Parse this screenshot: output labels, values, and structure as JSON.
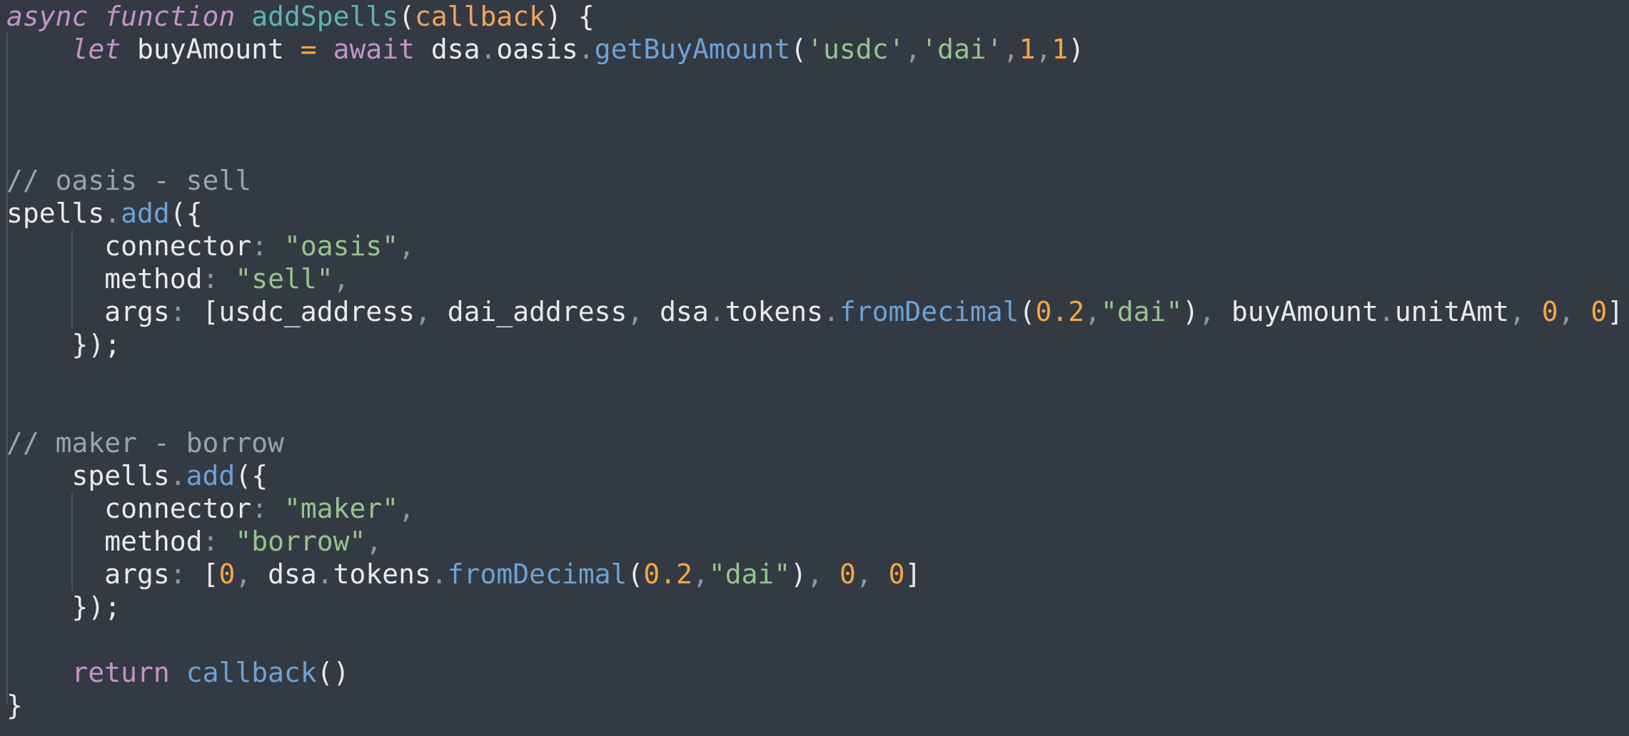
{
  "editor": {
    "theme_colors": {
      "background": "#333a44",
      "keyword": "#c792c8",
      "function_name": "#5fb3b3",
      "parameter": "#f0a45d",
      "method_call": "#6ea2d4",
      "string": "#97c48c",
      "number": "#f5a742",
      "comment": "#9aa3ad",
      "text": "#e8ebf0"
    },
    "lines": [
      {
        "tokens": [
          {
            "t": "async",
            "c": "kwi"
          },
          {
            "t": " ",
            "c": "plain"
          },
          {
            "t": "function",
            "c": "kwi"
          },
          {
            "t": " ",
            "c": "plain"
          },
          {
            "t": "addSpells",
            "c": "fn"
          },
          {
            "t": "(",
            "c": "plain"
          },
          {
            "t": "callback",
            "c": "param"
          },
          {
            "t": ") {",
            "c": "plain"
          }
        ]
      },
      {
        "tokens": [
          {
            "t": "    ",
            "c": "plain"
          },
          {
            "t": "let",
            "c": "kwi"
          },
          {
            "t": " buyAmount ",
            "c": "plain"
          },
          {
            "t": "=",
            "c": "op"
          },
          {
            "t": " ",
            "c": "plain"
          },
          {
            "t": "await",
            "c": "kw"
          },
          {
            "t": " dsa",
            "c": "plain"
          },
          {
            "t": ".",
            "c": "pun"
          },
          {
            "t": "oasis",
            "c": "plain"
          },
          {
            "t": ".",
            "c": "pun"
          },
          {
            "t": "getBuyAmount",
            "c": "call"
          },
          {
            "t": "(",
            "c": "plain"
          },
          {
            "t": "'usdc'",
            "c": "str"
          },
          {
            "t": ",",
            "c": "pun"
          },
          {
            "t": "'dai'",
            "c": "str"
          },
          {
            "t": ",",
            "c": "pun"
          },
          {
            "t": "1",
            "c": "num"
          },
          {
            "t": ",",
            "c": "pun"
          },
          {
            "t": "1",
            "c": "num"
          },
          {
            "t": ")",
            "c": "plain"
          }
        ]
      },
      {
        "tokens": []
      },
      {
        "tokens": []
      },
      {
        "tokens": []
      },
      {
        "tokens": [
          {
            "t": "// oasis - sell",
            "c": "cm"
          }
        ]
      },
      {
        "tokens": [
          {
            "t": "spells",
            "c": "plain"
          },
          {
            "t": ".",
            "c": "pun"
          },
          {
            "t": "add",
            "c": "call"
          },
          {
            "t": "({",
            "c": "plain"
          }
        ]
      },
      {
        "tokens": [
          {
            "t": "      connector",
            "c": "plain"
          },
          {
            "t": ": ",
            "c": "pun"
          },
          {
            "t": "\"oasis\"",
            "c": "str"
          },
          {
            "t": ",",
            "c": "pun"
          }
        ]
      },
      {
        "tokens": [
          {
            "t": "      method",
            "c": "plain"
          },
          {
            "t": ": ",
            "c": "pun"
          },
          {
            "t": "\"sell\"",
            "c": "str"
          },
          {
            "t": ",",
            "c": "pun"
          }
        ]
      },
      {
        "tokens": [
          {
            "t": "      args",
            "c": "plain"
          },
          {
            "t": ": ",
            "c": "pun"
          },
          {
            "t": "[usdc_address",
            "c": "plain"
          },
          {
            "t": ", ",
            "c": "pun"
          },
          {
            "t": "dai_address",
            "c": "plain"
          },
          {
            "t": ", ",
            "c": "pun"
          },
          {
            "t": "dsa",
            "c": "plain"
          },
          {
            "t": ".",
            "c": "pun"
          },
          {
            "t": "tokens",
            "c": "plain"
          },
          {
            "t": ".",
            "c": "pun"
          },
          {
            "t": "fromDecimal",
            "c": "call"
          },
          {
            "t": "(",
            "c": "plain"
          },
          {
            "t": "0.2",
            "c": "num"
          },
          {
            "t": ",",
            "c": "pun"
          },
          {
            "t": "\"dai\"",
            "c": "str"
          },
          {
            "t": ")",
            "c": "plain"
          },
          {
            "t": ", ",
            "c": "pun"
          },
          {
            "t": "buyAmount",
            "c": "plain"
          },
          {
            "t": ".",
            "c": "pun"
          },
          {
            "t": "unitAmt",
            "c": "plain"
          },
          {
            "t": ", ",
            "c": "pun"
          },
          {
            "t": "0",
            "c": "num"
          },
          {
            "t": ", ",
            "c": "pun"
          },
          {
            "t": "0",
            "c": "num"
          },
          {
            "t": "]",
            "c": "plain"
          }
        ]
      },
      {
        "tokens": [
          {
            "t": "    });",
            "c": "plain"
          }
        ]
      },
      {
        "tokens": []
      },
      {
        "tokens": []
      },
      {
        "tokens": [
          {
            "t": "// maker - borrow",
            "c": "cm"
          }
        ]
      },
      {
        "tokens": [
          {
            "t": "    spells",
            "c": "plain"
          },
          {
            "t": ".",
            "c": "pun"
          },
          {
            "t": "add",
            "c": "call"
          },
          {
            "t": "({",
            "c": "plain"
          }
        ]
      },
      {
        "tokens": [
          {
            "t": "      connector",
            "c": "plain"
          },
          {
            "t": ": ",
            "c": "pun"
          },
          {
            "t": "\"maker\"",
            "c": "str"
          },
          {
            "t": ",",
            "c": "pun"
          }
        ]
      },
      {
        "tokens": [
          {
            "t": "      method",
            "c": "plain"
          },
          {
            "t": ": ",
            "c": "pun"
          },
          {
            "t": "\"borrow\"",
            "c": "str"
          },
          {
            "t": ",",
            "c": "pun"
          }
        ]
      },
      {
        "tokens": [
          {
            "t": "      args",
            "c": "plain"
          },
          {
            "t": ": ",
            "c": "pun"
          },
          {
            "t": "[",
            "c": "plain"
          },
          {
            "t": "0",
            "c": "num"
          },
          {
            "t": ", ",
            "c": "pun"
          },
          {
            "t": "dsa",
            "c": "plain"
          },
          {
            "t": ".",
            "c": "pun"
          },
          {
            "t": "tokens",
            "c": "plain"
          },
          {
            "t": ".",
            "c": "pun"
          },
          {
            "t": "fromDecimal",
            "c": "call"
          },
          {
            "t": "(",
            "c": "plain"
          },
          {
            "t": "0.2",
            "c": "num"
          },
          {
            "t": ",",
            "c": "pun"
          },
          {
            "t": "\"dai\"",
            "c": "str"
          },
          {
            "t": ")",
            "c": "plain"
          },
          {
            "t": ", ",
            "c": "pun"
          },
          {
            "t": "0",
            "c": "num"
          },
          {
            "t": ", ",
            "c": "pun"
          },
          {
            "t": "0",
            "c": "num"
          },
          {
            "t": "]",
            "c": "plain"
          }
        ]
      },
      {
        "tokens": [
          {
            "t": "    });",
            "c": "plain"
          }
        ]
      },
      {
        "tokens": []
      },
      {
        "tokens": [
          {
            "t": "    ",
            "c": "plain"
          },
          {
            "t": "return",
            "c": "kw"
          },
          {
            "t": " ",
            "c": "plain"
          },
          {
            "t": "callback",
            "c": "call"
          },
          {
            "t": "()",
            "c": "plain"
          }
        ]
      },
      {
        "tokens": [
          {
            "t": "}",
            "c": "plain"
          }
        ]
      }
    ]
  }
}
